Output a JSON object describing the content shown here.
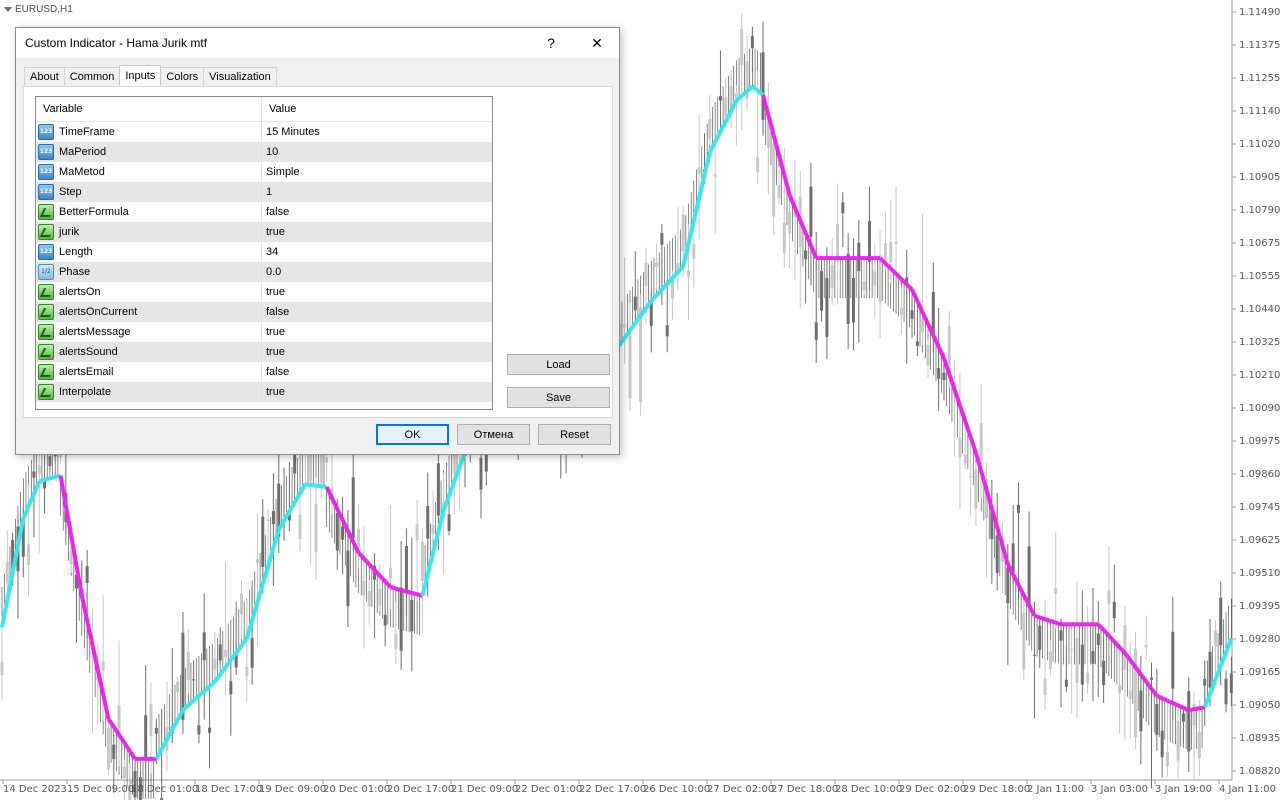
{
  "chart": {
    "symbol": "EURUSD,H1",
    "price_labels": [
      "1.11490",
      "1.11375",
      "1.11255",
      "1.11140",
      "1.11020",
      "1.10905",
      "1.10790",
      "1.10675",
      "1.10555",
      "1.10440",
      "1.10325",
      "1.10210",
      "1.10090",
      "1.09975",
      "1.09860",
      "1.09745",
      "1.09625",
      "1.09510",
      "1.09395",
      "1.09280",
      "1.09165",
      "1.09050",
      "1.08935",
      "1.08820"
    ],
    "time_labels": [
      "14 Dec 2023",
      "15 Dec 09:00",
      "18 Dec 01:00",
      "18 Dec 17:00",
      "19 Dec 09:00",
      "20 Dec 01:00",
      "20 Dec 17:00",
      "21 Dec 09:00",
      "22 Dec 01:00",
      "22 Dec 17:00",
      "26 Dec 10:00",
      "27 Dec 02:00",
      "27 Dec 18:00",
      "28 Dec 10:00",
      "29 Dec 02:00",
      "29 Dec 18:00",
      "2 Jan 11:00",
      "3 Jan 03:00",
      "3 Jan 19:00",
      "4 Jan 11:00"
    ],
    "colors": {
      "up_line": "#33e8ee",
      "down_line": "#ee22ee",
      "bull_candle": "#c8c8c8",
      "bear_candle": "#6e6e6e",
      "grid": "#d8d8d8"
    },
    "indicator_points": [
      [
        0,
        1.0934,
        "up"
      ],
      [
        8,
        1.0972,
        "up"
      ],
      [
        14,
        1.0985,
        "up"
      ],
      [
        22,
        1.0987,
        "down"
      ],
      [
        30,
        1.0945,
        "down"
      ],
      [
        40,
        1.0902,
        "down"
      ],
      [
        50,
        1.0888,
        "down"
      ],
      [
        58,
        1.0888,
        "up"
      ],
      [
        68,
        1.0905,
        "up"
      ],
      [
        80,
        1.0915,
        "up"
      ],
      [
        92,
        1.093,
        "up"
      ],
      [
        104,
        1.0968,
        "up"
      ],
      [
        114,
        1.0984,
        "up"
      ],
      [
        122,
        1.0983,
        "down"
      ],
      [
        134,
        1.096,
        "down"
      ],
      [
        146,
        1.0948,
        "down"
      ],
      [
        158,
        1.0945,
        "up"
      ],
      [
        166,
        1.0975,
        "up"
      ],
      [
        174,
        1.0995,
        "up"
      ],
      [
        186,
        1.1021,
        "up"
      ],
      [
        212,
        1.1021,
        "up"
      ],
      [
        230,
        1.103,
        "up"
      ],
      [
        244,
        1.1048,
        "up"
      ],
      [
        256,
        1.106,
        "up"
      ],
      [
        266,
        1.11,
        "up"
      ],
      [
        276,
        1.1118,
        "up"
      ],
      [
        282,
        1.1123,
        "up"
      ],
      [
        286,
        1.112,
        "down"
      ],
      [
        296,
        1.1085,
        "down"
      ],
      [
        306,
        1.1063,
        "down"
      ],
      [
        330,
        1.1063,
        "down"
      ],
      [
        342,
        1.1052,
        "down"
      ],
      [
        354,
        1.1028,
        "down"
      ],
      [
        366,
        1.0995,
        "down"
      ],
      [
        378,
        1.0956,
        "down"
      ],
      [
        388,
        1.0938,
        "down"
      ],
      [
        398,
        1.0935,
        "down"
      ],
      [
        412,
        1.0935,
        "down"
      ],
      [
        422,
        1.0925,
        "down"
      ],
      [
        434,
        1.091,
        "down"
      ],
      [
        446,
        1.0905,
        "down"
      ],
      [
        452,
        1.0906,
        "up"
      ],
      [
        462,
        1.093,
        "up"
      ]
    ]
  },
  "dialog": {
    "title": "Custom Indicator - Hama Jurik mtf",
    "help": "?",
    "close": "✕",
    "tabs": [
      "About",
      "Common",
      "Inputs",
      "Colors",
      "Visualization"
    ],
    "columns": {
      "variable": "Variable",
      "value": "Value"
    },
    "rows": [
      {
        "icon": "int",
        "name": "TimeFrame",
        "value": "15 Minutes"
      },
      {
        "icon": "int",
        "name": "MaPeriod",
        "value": "10"
      },
      {
        "icon": "int",
        "name": "MaMetod",
        "value": "Simple"
      },
      {
        "icon": "int",
        "name": "Step",
        "value": "1"
      },
      {
        "icon": "bool",
        "name": "BetterFormula",
        "value": "false"
      },
      {
        "icon": "bool",
        "name": "jurik",
        "value": "true"
      },
      {
        "icon": "int",
        "name": "Length",
        "value": "34"
      },
      {
        "icon": "dbl",
        "name": "Phase",
        "value": "0.0"
      },
      {
        "icon": "bool",
        "name": "alertsOn",
        "value": "true"
      },
      {
        "icon": "bool",
        "name": "alertsOnCurrent",
        "value": "false"
      },
      {
        "icon": "bool",
        "name": "alertsMessage",
        "value": "true"
      },
      {
        "icon": "bool",
        "name": "alertsSound",
        "value": "true"
      },
      {
        "icon": "bool",
        "name": "alertsEmail",
        "value": "false"
      },
      {
        "icon": "bool",
        "name": "Interpolate",
        "value": "true"
      }
    ],
    "buttons": {
      "load": "Load",
      "save": "Save",
      "ok": "OK",
      "cancel": "Отмена",
      "reset": "Reset"
    }
  }
}
